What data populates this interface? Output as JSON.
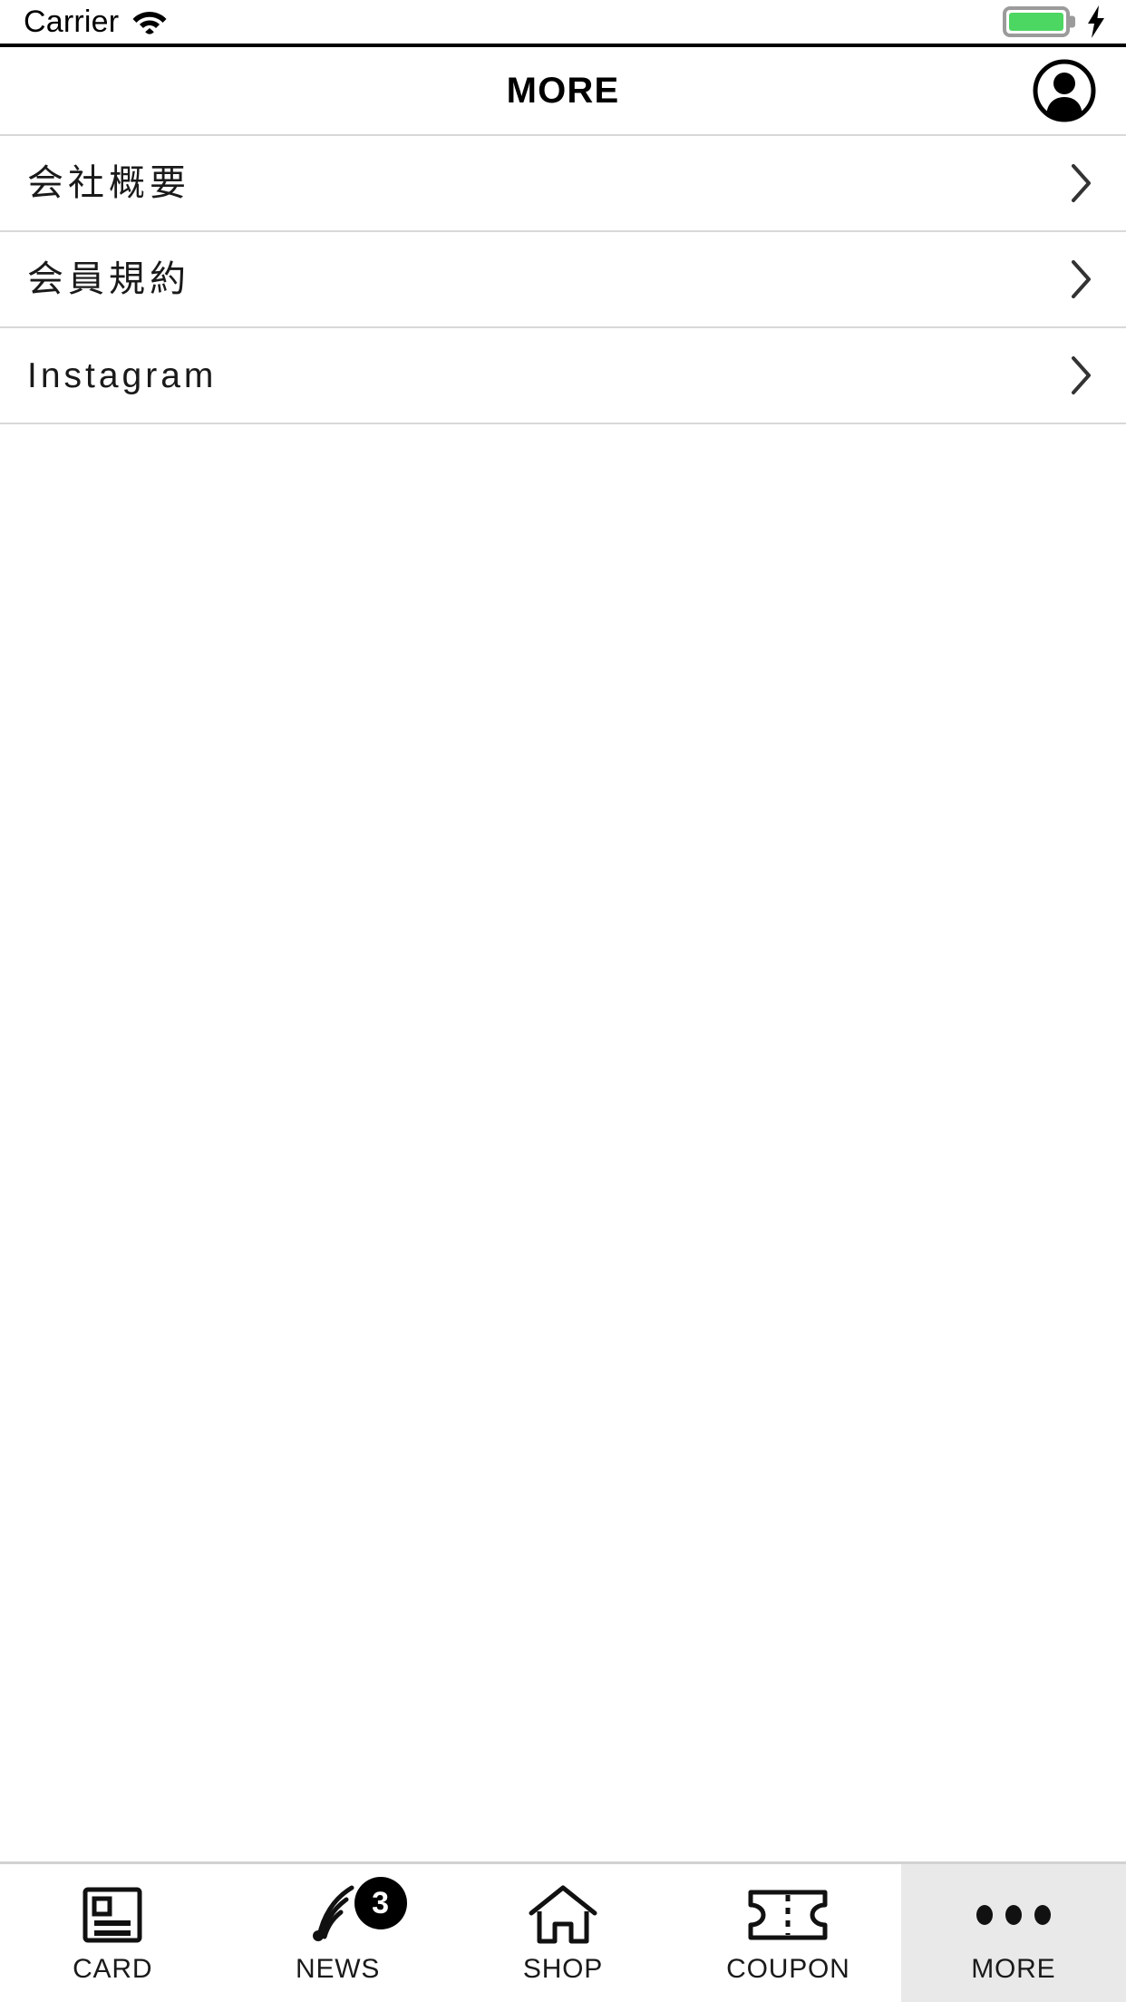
{
  "status_bar": {
    "carrier": "Carrier",
    "wifi_icon": "wifi-icon",
    "battery_icon": "battery-icon",
    "battery_color": "#4cd662",
    "charging_icon": "lightning-bolt-icon"
  },
  "header": {
    "title": "MORE",
    "account_icon": "account-avatar-icon"
  },
  "menu": {
    "items": [
      {
        "label": "会社概要",
        "chevron": "chevron-right-icon",
        "script": "ja"
      },
      {
        "label": "会員規約",
        "chevron": "chevron-right-icon",
        "script": "ja"
      },
      {
        "label": "Instagram",
        "chevron": "chevron-right-icon",
        "script": "latin"
      }
    ]
  },
  "tabbar": {
    "active_tab": "MORE",
    "active_bg": "#e9e9e9",
    "tabs": [
      {
        "label": "CARD",
        "icon": "card-icon",
        "badge": null
      },
      {
        "label": "NEWS",
        "icon": "rss-waves-icon",
        "badge": "3"
      },
      {
        "label": "SHOP",
        "icon": "home-icon",
        "badge": null
      },
      {
        "label": "COUPON",
        "icon": "ticket-icon",
        "badge": null
      },
      {
        "label": "MORE",
        "icon": "ellipsis-icon",
        "badge": null
      }
    ]
  }
}
